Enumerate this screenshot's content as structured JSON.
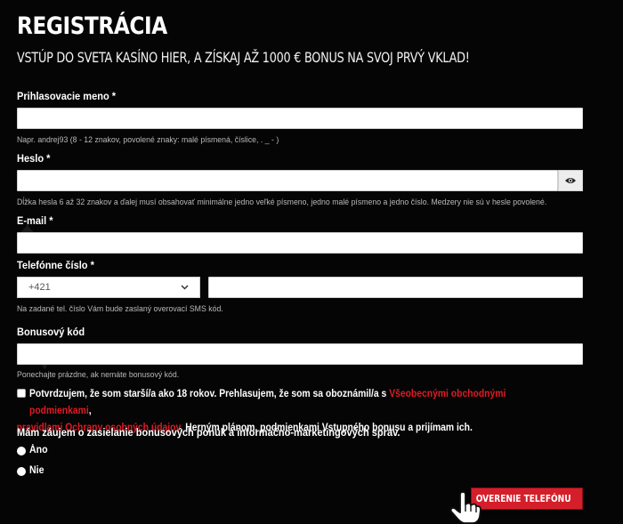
{
  "header": {
    "title": "REGISTRÁCIA",
    "subtitle": "VSTÚP DO SVETA KASÍNO HIER, A ZÍSKAJ AŽ 1000 € BONUS NA SVOJ PRVÝ VKLAD!"
  },
  "fields": {
    "username": {
      "label": "Prihlasovacie meno *",
      "value": "",
      "hint": "Napr. andrej93 (8 - 12 znakov, povolené znaky: malé písmená, číslice, . _ - )"
    },
    "password": {
      "label": "Heslo *",
      "value": "",
      "hint": "Dĺžka hesla 6 až 32 znakov a ďalej musí obsahovať minimálne jedno veľké písmeno, jedno malé písmeno a jedno číslo. Medzery nie sú v hesle povolené."
    },
    "email": {
      "label": "E-mail *",
      "value": ""
    },
    "phone": {
      "label": "Telefónne číslo *",
      "prefix": "+421",
      "value": "",
      "hint": "Na zadané tel. číslo Vám bude zaslaný overovací SMS kód."
    },
    "bonus": {
      "label": "Bonusový kód",
      "value": "",
      "hint": "Ponechajte prázdne, ak nemáte bonusový kód."
    }
  },
  "consent": {
    "part1": "Potvrdzujem, že som starší/a ako 18 rokov. Prehlasujem, že som sa oboznámil/a s ",
    "link1": "Všeobecnými obchodnými podmienkami",
    "part2": ",",
    "link2": "pravidlami Ochrany osobných údajov",
    "part3": ", Herným plánom, podmienkami Vstupného bonusu a prijímam ich.",
    "checked": false
  },
  "marketing": {
    "question": "Mám záujem o zasielanie bonusových ponúk a informačno-marketingových správ.",
    "options": [
      {
        "label": "Áno"
      },
      {
        "label": "Nie"
      }
    ]
  },
  "submit": {
    "label": "OVERENIE TELEFÓNU"
  },
  "icons": {
    "password_toggle": "eye-icon",
    "select_caret": "chevron-down-icon",
    "submit_arrow": "arrow-right-icon",
    "pointer": "hand-pointer-icon"
  },
  "colors": {
    "background": "#050505",
    "accent": "#d41f2b",
    "link": "#e01a24"
  }
}
